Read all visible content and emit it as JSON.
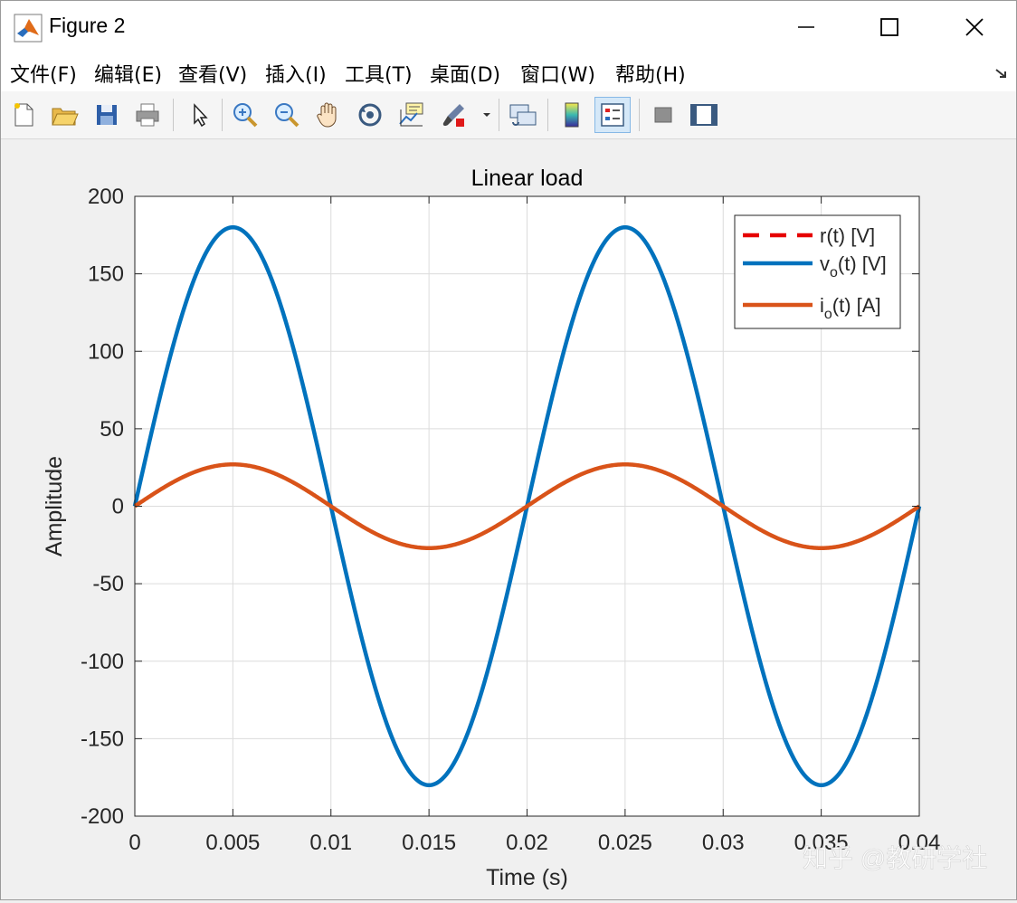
{
  "window": {
    "title": "Figure 2"
  },
  "menu": [
    {
      "label": "文件(F)"
    },
    {
      "label": "编辑(E)"
    },
    {
      "label": "查看(V)"
    },
    {
      "label": "插入(I)"
    },
    {
      "label": "工具(T)"
    },
    {
      "label": "桌面(D)"
    },
    {
      "label": "窗口(W)"
    },
    {
      "label": "帮助(H)"
    }
  ],
  "toolbar": {
    "icons": [
      "new-figure-icon",
      "open-file-icon",
      "save-icon",
      "print-icon",
      "arrow-pointer-icon",
      "zoom-in-icon",
      "zoom-out-icon",
      "pan-hand-icon",
      "rotate-3d-icon",
      "data-cursor-icon",
      "brush-icon",
      "link-plot-icon",
      "colorbar-icon",
      "legend-icon",
      "hide-plot-tools-icon",
      "show-plot-tools-icon"
    ]
  },
  "watermark": "知乎 @教研学社",
  "colors": {
    "vo": "#0072bd",
    "io": "#d95319",
    "r": "#e60000"
  },
  "chart_data": {
    "type": "line",
    "title": "Linear load",
    "xlabel": "Time (s)",
    "ylabel": "Amplitude",
    "xlim": [
      0,
      0.04
    ],
    "ylim": [
      -200,
      200
    ],
    "xticks": [
      "0",
      "0.005",
      "0.01",
      "0.015",
      "0.02",
      "0.025",
      "0.03",
      "0.035",
      "0.04"
    ],
    "yticks": [
      "200",
      "150",
      "100",
      "50",
      "0",
      "-50",
      "-100",
      "-150",
      "-200"
    ],
    "grid": true,
    "legend_position": "top-right",
    "legend": [
      {
        "base": "r",
        "sub": "",
        "suffix": "(t) [V]"
      },
      {
        "base": "v",
        "sub": "o",
        "suffix": "(t) [V]"
      },
      {
        "base": "i",
        "sub": "o",
        "suffix": "(t) [A]"
      }
    ],
    "series": [
      {
        "name": "r(t) [V]",
        "style": "dashed",
        "color": "#e60000",
        "amplitude": 180,
        "frequency_hz": 50,
        "visible": false
      },
      {
        "name": "vo(t) [V]",
        "style": "solid",
        "color": "#0072bd",
        "amplitude": 180,
        "frequency_hz": 50
      },
      {
        "name": "io(t) [A]",
        "style": "solid",
        "color": "#d95319",
        "amplitude": 27,
        "frequency_hz": 50
      }
    ]
  }
}
